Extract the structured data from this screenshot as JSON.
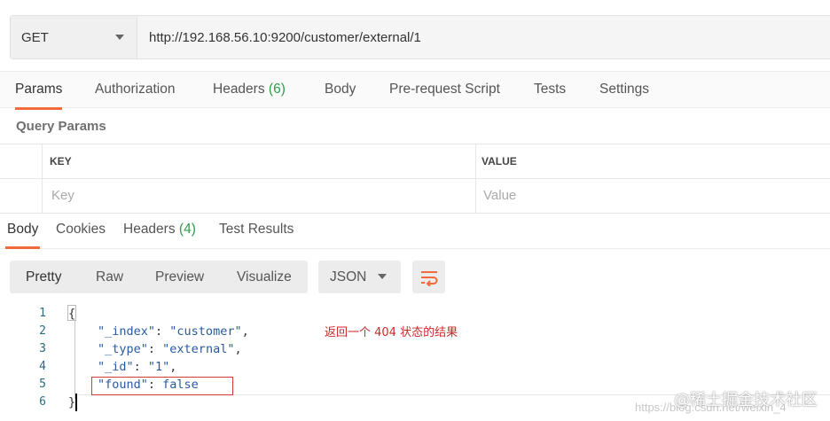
{
  "request": {
    "method": "GET",
    "url": "http://192.168.56.10:9200/customer/external/1"
  },
  "request_tabs": [
    {
      "label": "Params",
      "count": ""
    },
    {
      "label": "Authorization",
      "count": ""
    },
    {
      "label": "Headers",
      "count": "(6)"
    },
    {
      "label": "Body",
      "count": ""
    },
    {
      "label": "Pre-request Script",
      "count": ""
    },
    {
      "label": "Tests",
      "count": ""
    },
    {
      "label": "Settings",
      "count": ""
    }
  ],
  "query_params": {
    "title": "Query Params",
    "key_header": "KEY",
    "value_header": "VALUE",
    "key_placeholder": "Key",
    "value_placeholder": "Value"
  },
  "response_tabs": [
    {
      "label": "Body",
      "count": ""
    },
    {
      "label": "Cookies",
      "count": ""
    },
    {
      "label": "Headers",
      "count": "(4)"
    },
    {
      "label": "Test Results",
      "count": ""
    }
  ],
  "view_modes": [
    "Pretty",
    "Raw",
    "Preview",
    "Visualize"
  ],
  "format": "JSON",
  "code_lines": [
    {
      "num": "1",
      "text": "{"
    },
    {
      "num": "2",
      "key": "\"_index\"",
      "value": "\"customer\"",
      "trail": ","
    },
    {
      "num": "3",
      "key": "\"_type\"",
      "value": "\"external\"",
      "trail": ","
    },
    {
      "num": "4",
      "key": "\"_id\"",
      "value": "\"1\"",
      "trail": ","
    },
    {
      "num": "5",
      "key": "\"found\"",
      "value": "false",
      "trail": ""
    },
    {
      "num": "6",
      "text": "}"
    }
  ],
  "annotation": "返回一个 404 状态的结果",
  "watermark": {
    "brand": "@稀土掘金技术社区",
    "url": "https://blog.csdn.net/weixin_4"
  },
  "colors": {
    "accent": "#f26b3a",
    "count": "#2b9e48",
    "annotation": "#c82a2a"
  }
}
